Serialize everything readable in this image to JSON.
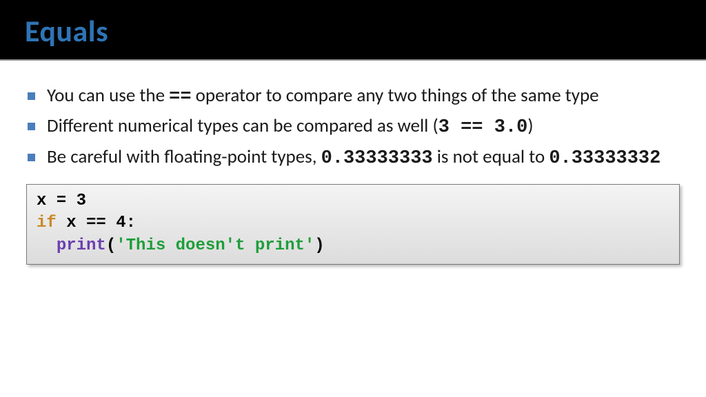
{
  "title": "Equals",
  "bullets": [
    {
      "pre": "You can use the ",
      "mono": "==",
      "post": " operator to compare any two things of the same type"
    },
    {
      "pre": "Different numerical types can be compared as well (",
      "mono": "3 == 3.0",
      "post": ")"
    },
    {
      "parts": [
        {
          "t": "Be careful with floating-point types, "
        },
        {
          "t": "0.33333333",
          "mono": true
        },
        {
          "t": " is not equal to "
        },
        {
          "t": "0.33333332",
          "mono": true
        }
      ]
    }
  ],
  "code": {
    "line1_plain": "x = 3",
    "line2_kw": "if",
    "line2_rest": " x == 4:",
    "line3_indent": "  ",
    "line3_fn": "print",
    "line3_open": "(",
    "line3_str": "'This doesn't print'",
    "line3_close": ")"
  }
}
